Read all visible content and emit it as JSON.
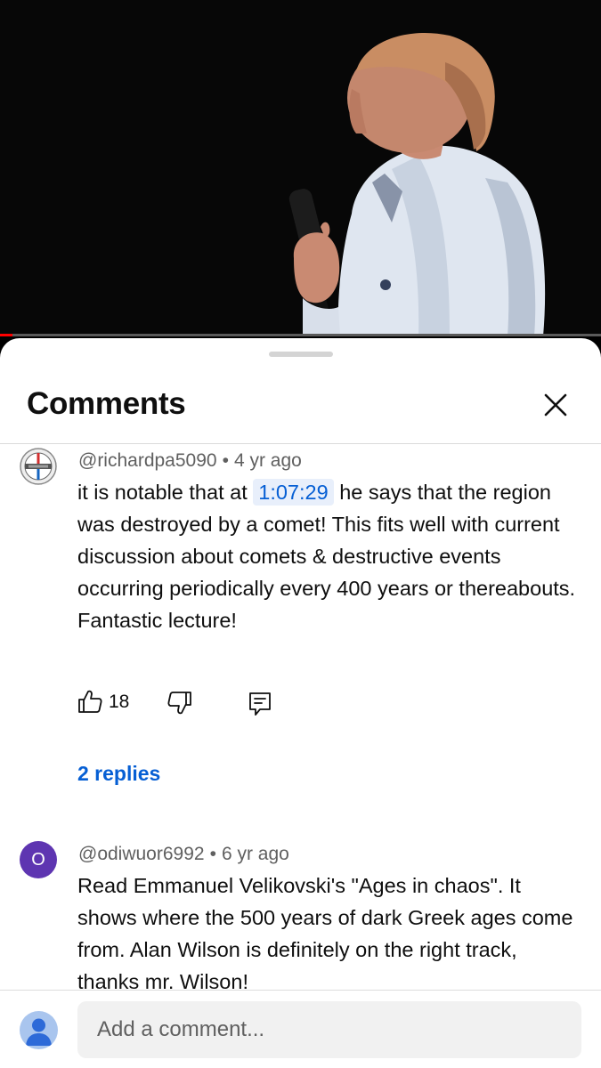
{
  "video": {
    "progress_fraction": 0.02,
    "colors": {
      "background": "#070707",
      "progress_fill": "#ff0000",
      "progress_track": "#5a5a5a"
    }
  },
  "sheet": {
    "title": "Comments",
    "close_icon": "close-icon"
  },
  "comments": [
    {
      "author": "@richardpa5090",
      "separator": "•",
      "age": "4 yr ago",
      "text_before": "it is notable that at",
      "timestamp": "1:07:29",
      "text_after": "he says that the region was destroyed by a comet!  This fits well with current discussion about comets & destructive events occurring periodically every 400 years or thereabouts.  Fantastic lecture!",
      "likes": "18",
      "replies": "2 replies"
    },
    {
      "author": "@odiwuor6992",
      "separator": "•",
      "age": "6 yr ago",
      "avatar_letter": "O",
      "avatar_color": "#5e35b1",
      "text": "Read Emmanuel Velikovski's \"Ages in chaos\". It shows where the 500 years of dark Greek ages come from. Alan Wilson is definitely on the right track, thanks mr. Wilson!"
    }
  ],
  "composer": {
    "placeholder": "Add a comment..."
  },
  "colors": {
    "link_blue": "#065fd4",
    "timestamp_bg": "#e8effb",
    "meta_gray": "#606060"
  }
}
